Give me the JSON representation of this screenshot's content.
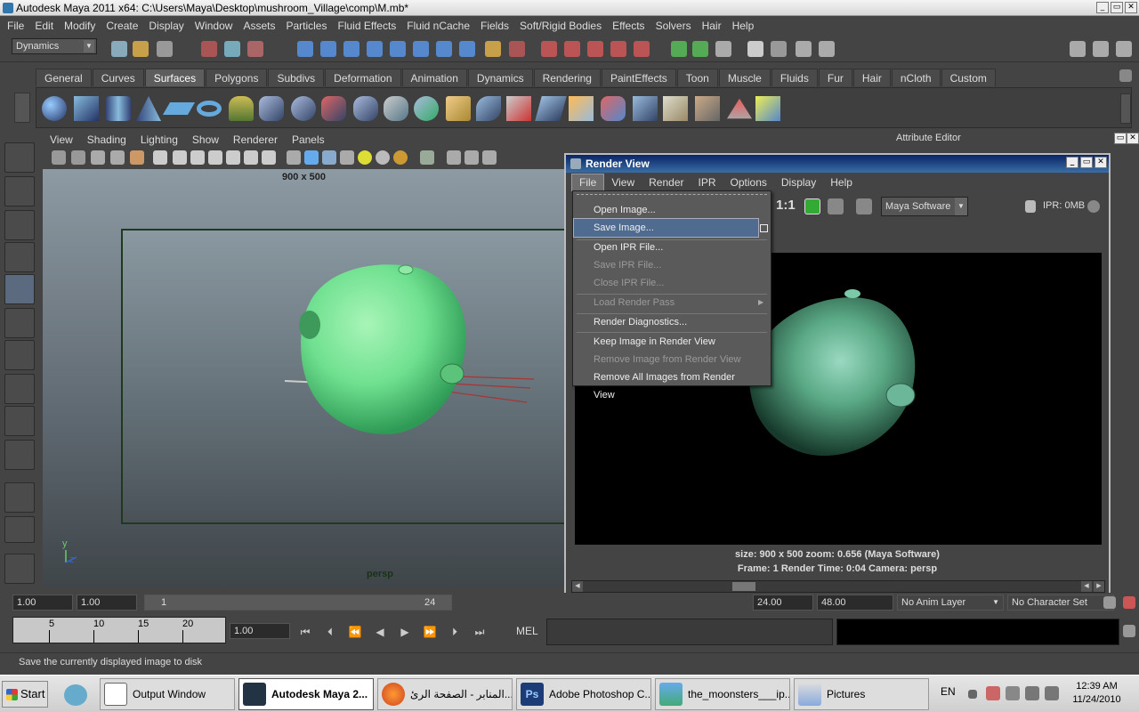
{
  "window": {
    "title": "Autodesk Maya 2011 x64: C:\\Users\\Maya\\Desktop\\mushroom_Village\\comp\\M.mb*"
  },
  "menubar": [
    "File",
    "Edit",
    "Modify",
    "Create",
    "Display",
    "Window",
    "Assets",
    "Particles",
    "Fluid Effects",
    "Fluid nCache",
    "Fields",
    "Soft/Rigid Bodies",
    "Effects",
    "Solvers",
    "Hair",
    "Help"
  ],
  "statusline": {
    "mode": "Dynamics"
  },
  "shelf": {
    "tabs": [
      "General",
      "Curves",
      "Surfaces",
      "Polygons",
      "Subdivs",
      "Deformation",
      "Animation",
      "Dynamics",
      "Rendering",
      "PaintEffects",
      "Toon",
      "Muscle",
      "Fluids",
      "Fur",
      "Hair",
      "nCloth",
      "Custom"
    ],
    "active_tab": "Surfaces"
  },
  "viewport": {
    "menu": [
      "View",
      "Shading",
      "Lighting",
      "Show",
      "Renderer",
      "Panels"
    ],
    "resolution": "900 x 500",
    "camera": "persp"
  },
  "attribute_editor": {
    "title": "Attribute Editor"
  },
  "render_view": {
    "title": "Render View",
    "menu": [
      "File",
      "View",
      "Render",
      "IPR",
      "Options",
      "Display",
      "Help"
    ],
    "open_menu": "File",
    "ratio": "1:1",
    "renderer": "Maya Software",
    "ipr": "IPR: 0MB",
    "info_line1": "size: 900 x 500  zoom: 0.656       (Maya Software)",
    "info_line2": "Frame: 1       Render Time: 0:04       Camera: persp"
  },
  "file_menu": {
    "items": [
      {
        "label": "Open Image...",
        "enabled": true
      },
      {
        "label": "Save Image...",
        "enabled": true,
        "highlighted": true
      },
      {
        "label": "Open IPR File...",
        "enabled": true
      },
      {
        "label": "Save IPR File...",
        "enabled": false
      },
      {
        "label": "Close IPR File...",
        "enabled": false
      },
      {
        "label": "Load Render Pass",
        "enabled": false
      },
      {
        "label": "Render Diagnostics...",
        "enabled": true
      },
      {
        "label": "Keep Image in Render View",
        "enabled": true
      },
      {
        "label": "Remove Image from Render View",
        "enabled": false
      },
      {
        "label": "Remove All Images from Render View",
        "enabled": true
      }
    ]
  },
  "range": {
    "start": "1.00",
    "playback_start": "1.00",
    "slider_start": "1",
    "slider_end": "24",
    "playback_end": "24.00",
    "end": "48.00",
    "anim_layer": "No Anim Layer",
    "character_set": "No Character Set"
  },
  "timeline": {
    "ticks": [
      "5",
      "10",
      "15",
      "20"
    ],
    "current_time": "1.00"
  },
  "command_line": {
    "label": "MEL"
  },
  "help_line": "Save the currently displayed image to disk",
  "taskbar": {
    "start": "Start",
    "items": [
      {
        "label": "Output Window"
      },
      {
        "label": "Autodesk Maya 2...",
        "active": true
      },
      {
        "label": "المنابر - الصفحة الرئ..."
      },
      {
        "label": "Adobe Photoshop C..."
      },
      {
        "label": "the_moonsters___ip..."
      },
      {
        "label": "Pictures"
      }
    ],
    "language": "EN",
    "time": "12:39 AM",
    "date": "11/24/2010"
  },
  "colors": {
    "mushroom": "#6fe08f",
    "highlight": "#4f6b8f",
    "titlebar_active": "#0a2466"
  }
}
